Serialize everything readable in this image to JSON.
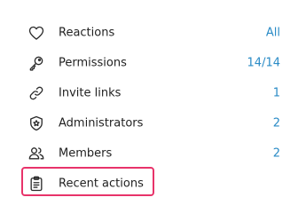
{
  "accent_color": "#2a8bc6",
  "highlight_color": "#e8336a",
  "menu": {
    "items": [
      {
        "label": "Reactions",
        "value": "All",
        "icon": "heart-icon"
      },
      {
        "label": "Permissions",
        "value": "14/14",
        "icon": "key-icon"
      },
      {
        "label": "Invite links",
        "value": "1",
        "icon": "link-icon"
      },
      {
        "label": "Administrators",
        "value": "2",
        "icon": "shield-star-icon"
      },
      {
        "label": "Members",
        "value": "2",
        "icon": "users-icon"
      },
      {
        "label": "Recent actions",
        "value": "",
        "icon": "clipboard-icon",
        "highlighted": true
      }
    ]
  }
}
